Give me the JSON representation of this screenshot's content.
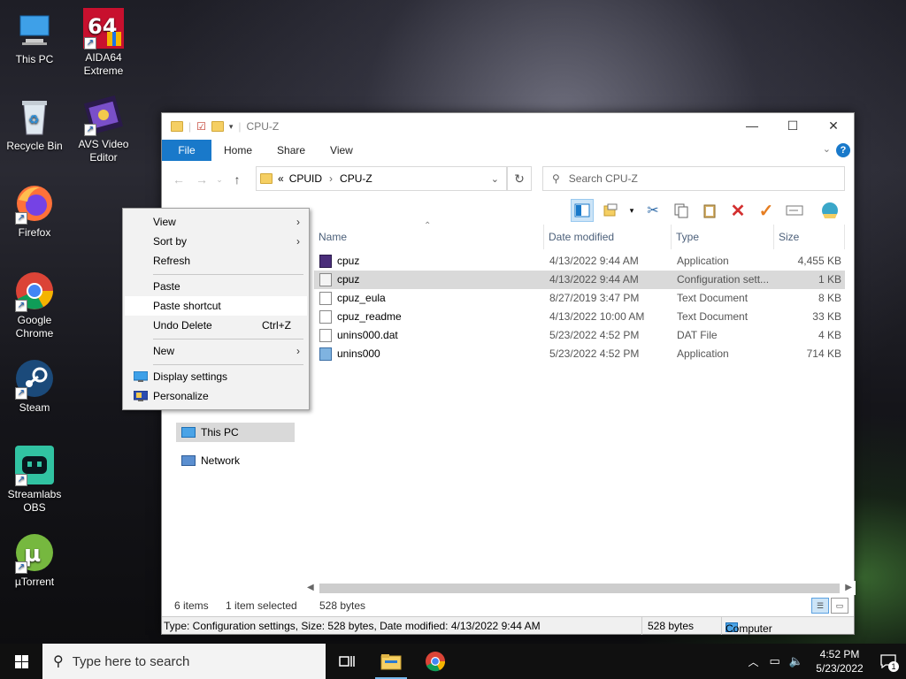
{
  "desktop": {
    "icons": [
      {
        "label": "This PC"
      },
      {
        "label": "AIDA64 Extreme"
      },
      {
        "label": "Recycle Bin"
      },
      {
        "label": "AVS Video Editor"
      },
      {
        "label": "Firefox"
      },
      {
        "label": "Google Chrome"
      },
      {
        "label": "Steam"
      },
      {
        "label": "Streamlabs OBS"
      },
      {
        "label": "µTorrent"
      }
    ]
  },
  "window": {
    "title": "CPU-Z",
    "tabs": [
      "File",
      "Home",
      "Share",
      "View"
    ],
    "address": {
      "prefix": "«",
      "crumbs": [
        "CPUID",
        "CPU-Z"
      ]
    },
    "search_placeholder": "Search CPU-Z",
    "columns": [
      "Name",
      "Date modified",
      "Type",
      "Size"
    ],
    "files": [
      {
        "name": "cpuz",
        "date": "4/13/2022 9:44 AM",
        "type": "Application",
        "size": "4,455 KB",
        "icon": "cpuz-app-icon"
      },
      {
        "name": "cpuz",
        "date": "4/13/2022 9:44 AM",
        "type": "Configuration sett...",
        "size": "1 KB",
        "icon": "config-file-icon"
      },
      {
        "name": "cpuz_eula",
        "date": "8/27/2019 3:47 PM",
        "type": "Text Document",
        "size": "8 KB",
        "icon": "text-file-icon"
      },
      {
        "name": "cpuz_readme",
        "date": "4/13/2022 10:00 AM",
        "type": "Text Document",
        "size": "33 KB",
        "icon": "text-file-icon"
      },
      {
        "name": "unins000.dat",
        "date": "5/23/2022 4:52 PM",
        "type": "DAT File",
        "size": "4 KB",
        "icon": "dat-file-icon"
      },
      {
        "name": "unins000",
        "date": "5/23/2022 4:52 PM",
        "type": "Application",
        "size": "714 KB",
        "icon": "uninstaller-icon"
      }
    ],
    "nav": {
      "this_pc": "This PC",
      "network": "Network"
    },
    "status": {
      "count": "6 items",
      "selected": "1 item selected",
      "bytes": "528 bytes"
    },
    "infobar": {
      "details": "Type: Configuration settings, Size: 528 bytes, Date modified: 4/13/2022 9:44 AM",
      "size": "528 bytes",
      "location": "Computer"
    }
  },
  "context_menu": {
    "items": {
      "view": "View",
      "sort_by": "Sort by",
      "refresh": "Refresh",
      "paste": "Paste",
      "paste_shortcut": "Paste shortcut",
      "undo_delete": "Undo Delete",
      "undo_shortcut": "Ctrl+Z",
      "new": "New",
      "display_settings": "Display settings",
      "personalize": "Personalize"
    },
    "highlighted": "Paste shortcut"
  },
  "taskbar": {
    "search_placeholder": "Type here to search",
    "time": "4:52 PM",
    "date": "5/23/2022",
    "notifications": "1"
  },
  "colors": {
    "accent": "#1979ca",
    "selection": "#d9d9d9",
    "taskbar": "#101010"
  }
}
